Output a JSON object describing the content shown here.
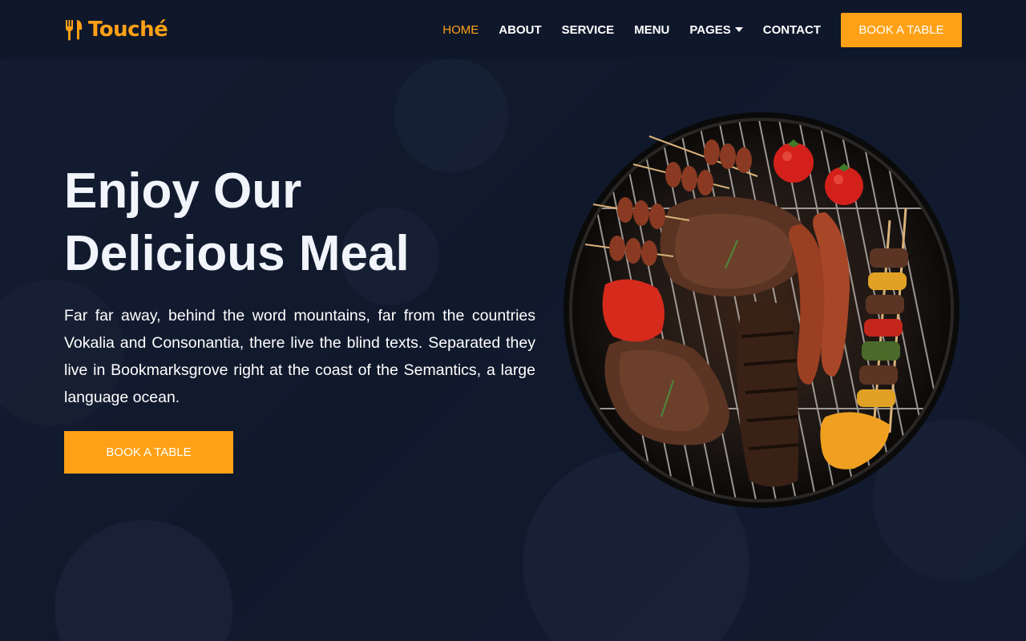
{
  "brand": {
    "name": "Touché",
    "icon": "utensils-icon"
  },
  "nav": {
    "items": [
      {
        "label": "HOME",
        "active": true
      },
      {
        "label": "ABOUT"
      },
      {
        "label": "SERVICE"
      },
      {
        "label": "MENU"
      },
      {
        "label": "PAGES",
        "has_dropdown": true
      },
      {
        "label": "CONTACT"
      }
    ],
    "cta_label": "BOOK A TABLE"
  },
  "hero": {
    "title_line1": "Enjoy Our",
    "title_line2": "Delicious Meal",
    "text": "Far far away, behind the word mountains, far from the countries Vokalia and Consonantia, there live the blind texts. Separated they live in Bookmarksgrove right at the coast of the Semantics, a large language ocean.",
    "cta_label": "BOOK A TABLE",
    "image": "barbecue-grill-image"
  },
  "colors": {
    "accent": "#fea116",
    "dark": "#0f172b",
    "text": "#ffffff"
  }
}
